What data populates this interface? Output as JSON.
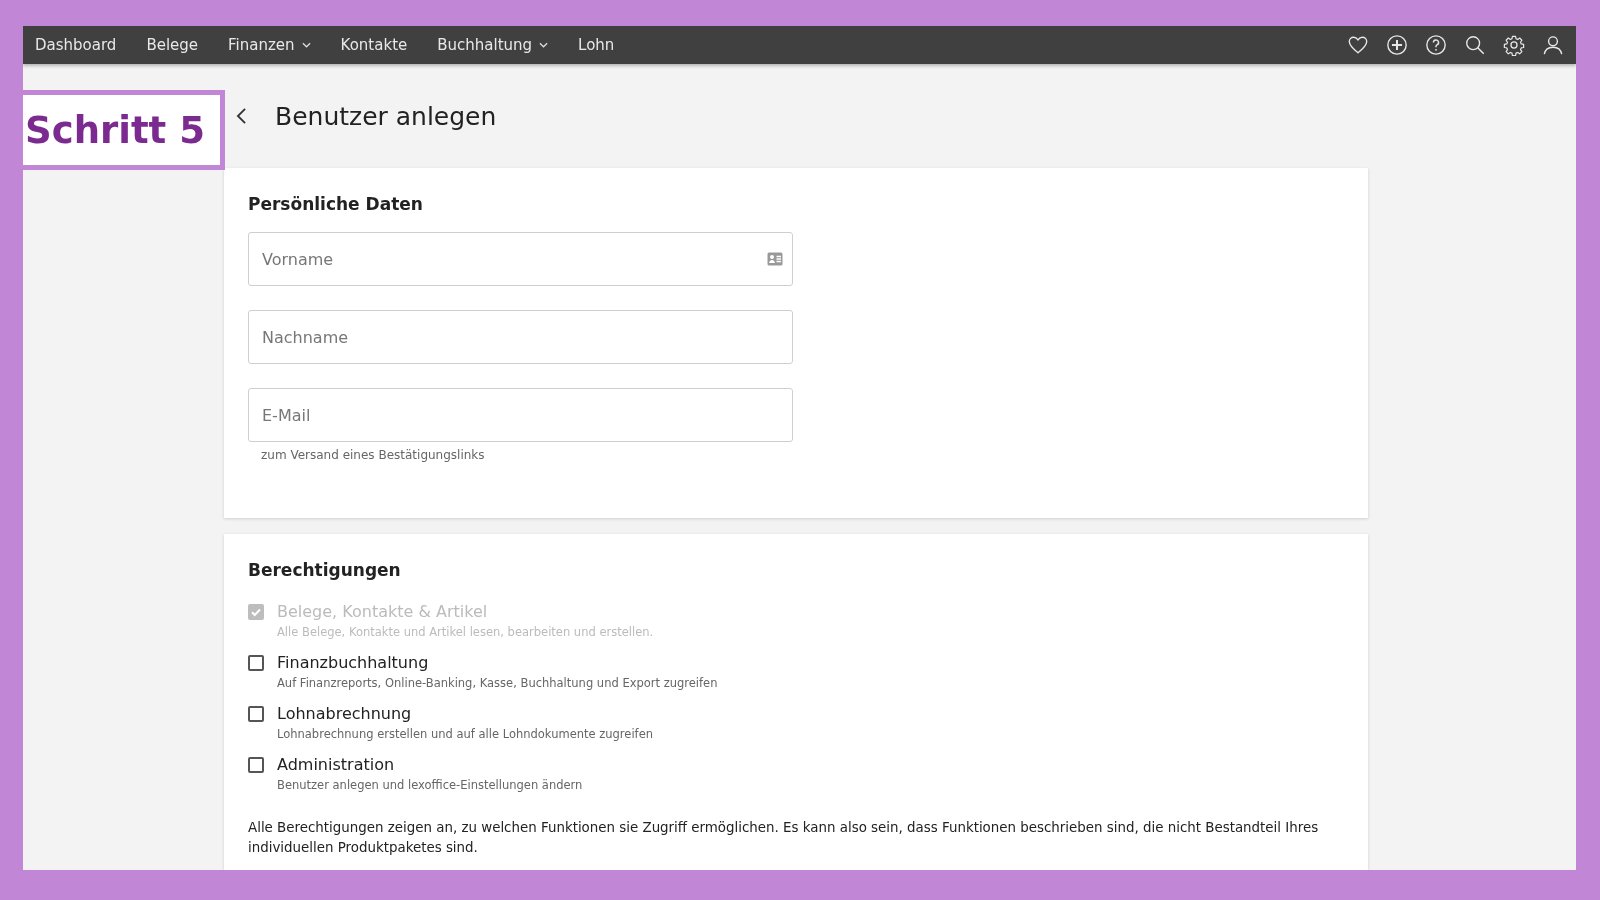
{
  "step_badge": {
    "label": "Schritt 5"
  },
  "nav": {
    "items": [
      {
        "label": "Dashboard",
        "has_dropdown": false
      },
      {
        "label": "Belege",
        "has_dropdown": false
      },
      {
        "label": "Finanzen",
        "has_dropdown": true
      },
      {
        "label": "Kontakte",
        "has_dropdown": false
      },
      {
        "label": "Buchhaltung",
        "has_dropdown": true
      },
      {
        "label": "Lohn",
        "has_dropdown": false
      }
    ]
  },
  "page": {
    "title": "Benutzer anlegen"
  },
  "personal": {
    "heading": "Persönliche Daten",
    "fields": [
      {
        "placeholder": "Vorname",
        "has_card_icon": true
      },
      {
        "placeholder": "Nachname",
        "has_card_icon": false
      },
      {
        "placeholder": "E-Mail",
        "has_card_icon": false,
        "hint": "zum Versand eines Bestätigungslinks"
      }
    ]
  },
  "permissions": {
    "heading": "Berechtigungen",
    "items": [
      {
        "label": "Belege, Kontakte & Artikel",
        "description": "Alle Belege, Kontakte und Artikel lesen, bearbeiten und erstellen.",
        "checked": true,
        "disabled": true
      },
      {
        "label": "Finanzbuchhaltung",
        "description": "Auf Finanzreports, Online-Banking, Kasse, Buchhaltung und Export zugreifen",
        "checked": false,
        "disabled": false
      },
      {
        "label": "Lohnabrechnung",
        "description": "Lohnabrechnung erstellen und auf alle Lohndokumente zugreifen",
        "checked": false,
        "disabled": false
      },
      {
        "label": "Administration",
        "description": "Benutzer anlegen und lexoffice-Einstellungen ändern",
        "checked": false,
        "disabled": false
      }
    ],
    "note": "Alle Berechtigungen zeigen an, zu welchen Funktionen sie Zugriff ermöglichen. Es kann also sein, dass Funktionen beschrieben sind, die nicht Bestandteil Ihres individuellen Produktpaketes sind."
  }
}
